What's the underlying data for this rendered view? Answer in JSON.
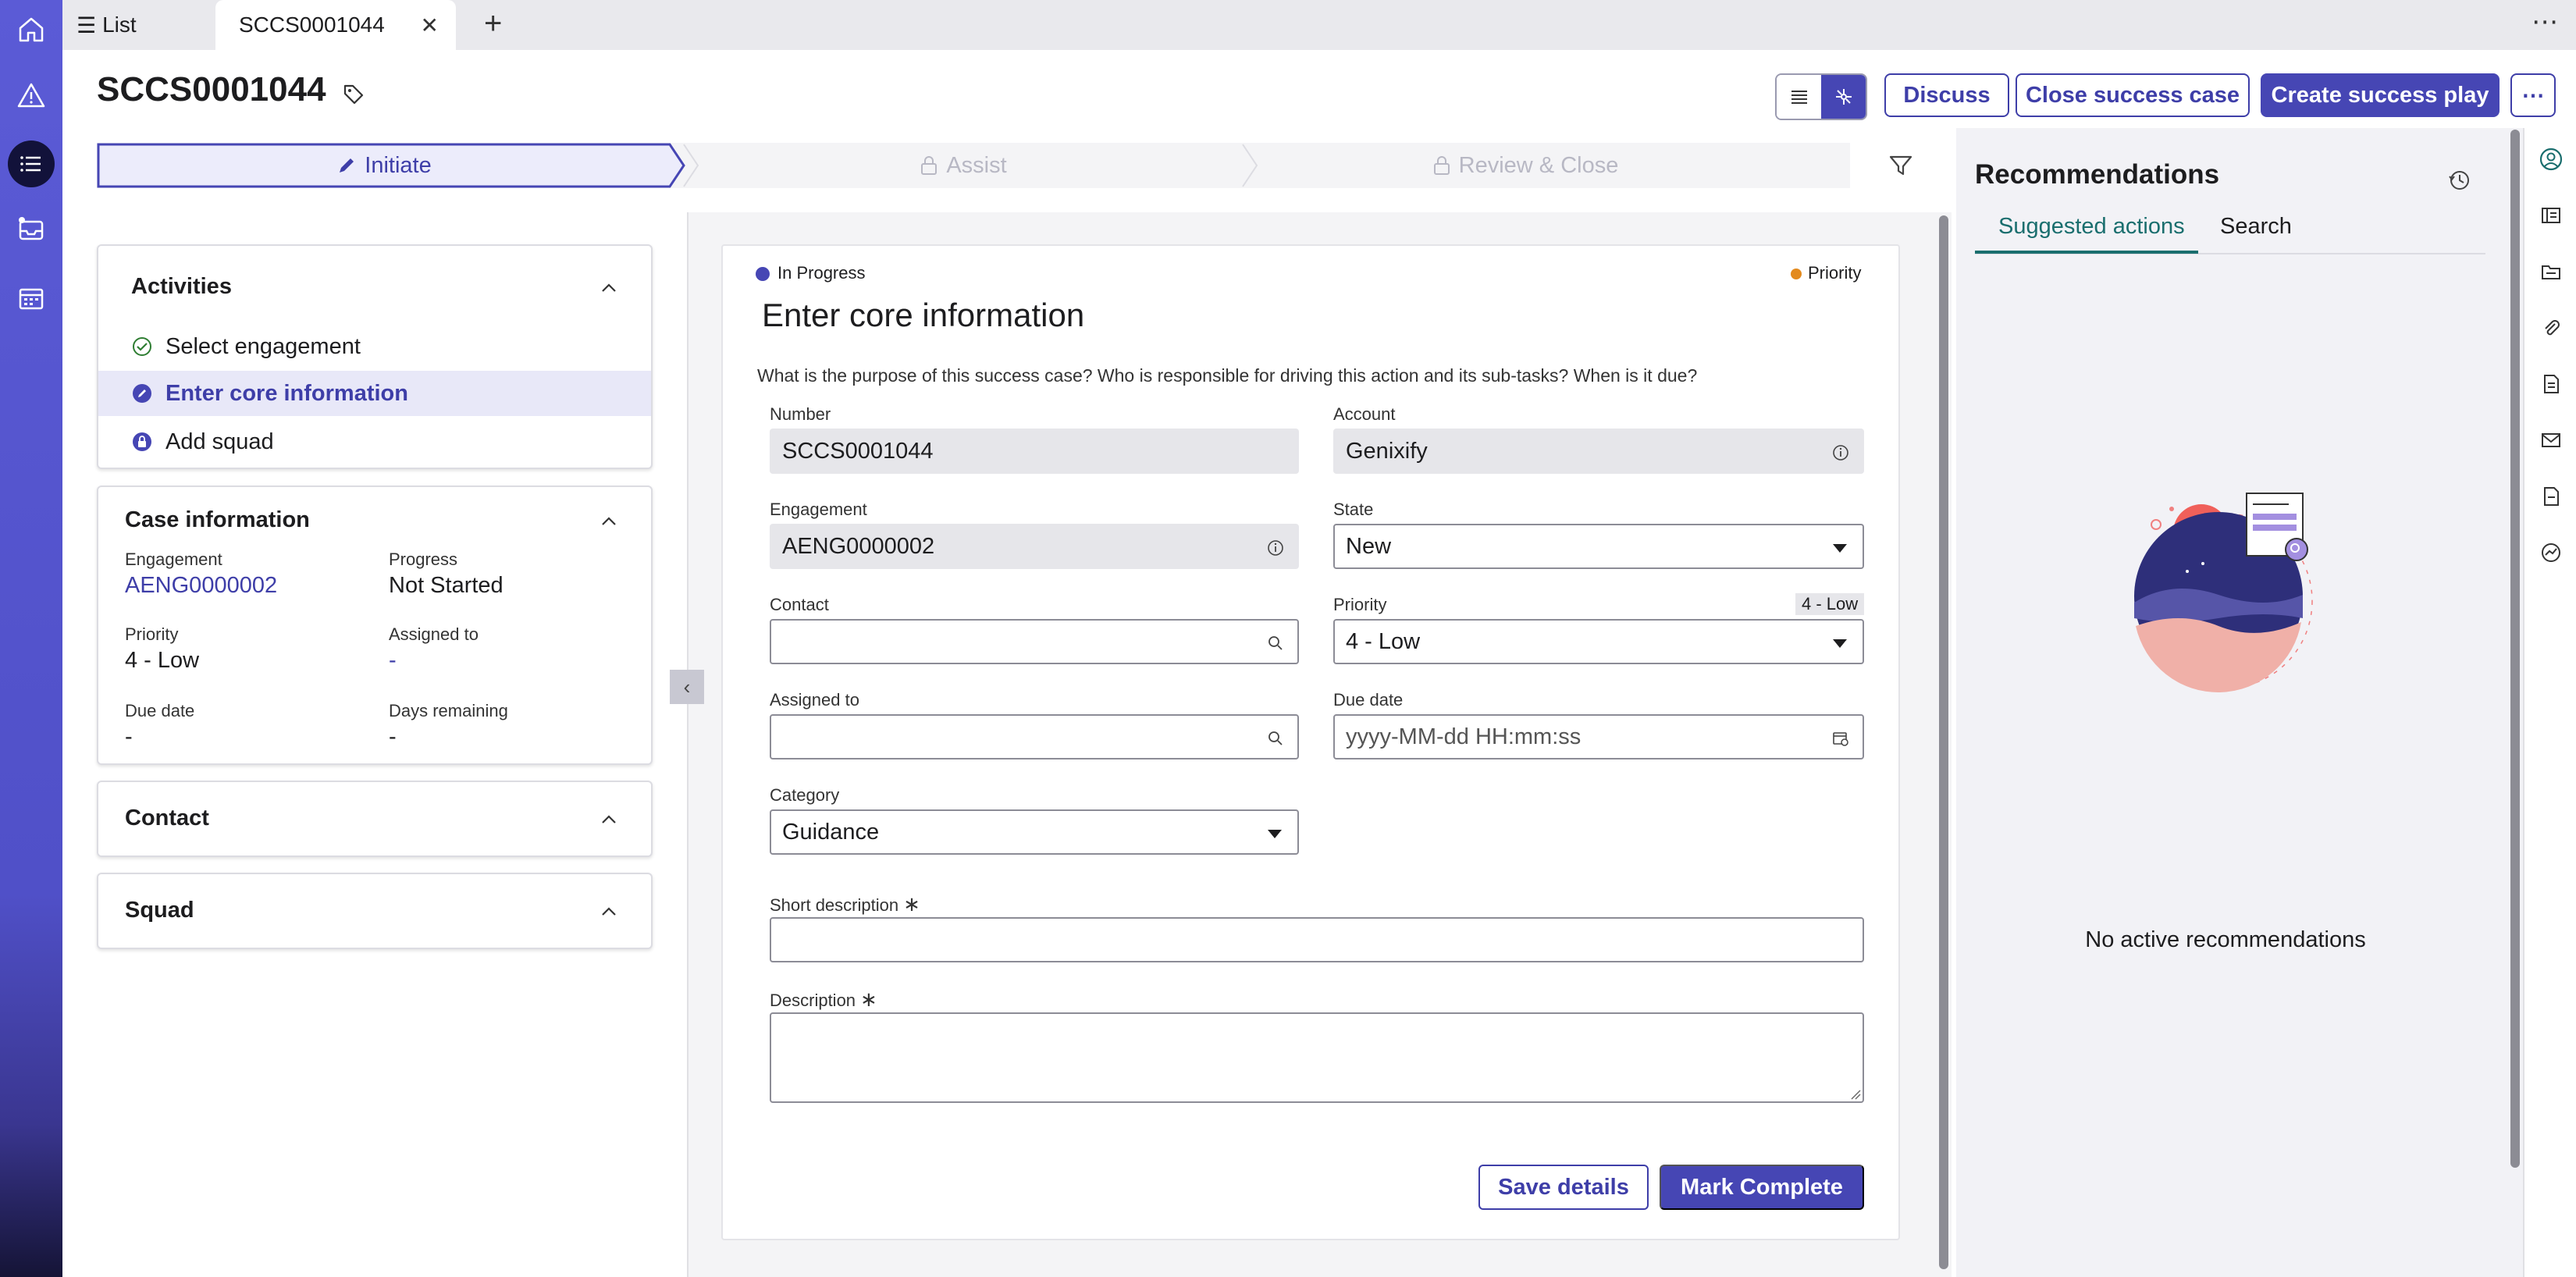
{
  "tabs": {
    "list_label": "List",
    "active_label": "SCCS0001044",
    "close_glyph": "✕",
    "add_glyph": "+",
    "more_glyph": "⋯"
  },
  "header": {
    "title": "SCCS0001044",
    "buttons": {
      "discuss": "Discuss",
      "close_case": "Close success case",
      "create_play": "Create success play",
      "more": "⋯"
    }
  },
  "stages": [
    {
      "label": "Initiate",
      "state": "active"
    },
    {
      "label": "Assist",
      "state": "locked"
    },
    {
      "label": "Review & Close",
      "state": "locked"
    }
  ],
  "activities": {
    "title": "Activities",
    "items": [
      {
        "label": "Select engagement",
        "status": "done"
      },
      {
        "label": "Enter core information",
        "status": "current"
      },
      {
        "label": "Add squad",
        "status": "locked"
      }
    ]
  },
  "case_info": {
    "title": "Case information",
    "engagement_label": "Engagement",
    "engagement_value": "AENG0000002",
    "progress_label": "Progress",
    "progress_value": "Not Started",
    "priority_label": "Priority",
    "priority_value": "4 - Low",
    "assigned_label": "Assigned to",
    "assigned_value": "-",
    "due_label": "Due date",
    "due_value": "-",
    "days_label": "Days remaining",
    "days_value": "-"
  },
  "contact_card": {
    "title": "Contact"
  },
  "squad_card": {
    "title": "Squad"
  },
  "form": {
    "status": "In Progress",
    "priority_tag": "Priority",
    "heading": "Enter core information",
    "question": "What is the purpose of this success case? Who is responsible for driving this action and its sub-tasks? When is it due?",
    "number_label": "Number",
    "number_value": "SCCS0001044",
    "account_label": "Account",
    "account_value": "Genixify",
    "engagement_label": "Engagement",
    "engagement_value": "AENG0000002",
    "state_label": "State",
    "state_value": "New",
    "contact_label": "Contact",
    "contact_value": "",
    "priority_label": "Priority",
    "priority_badge": "4 - Low",
    "priority_value": "4 - Low",
    "assigned_label": "Assigned to",
    "assigned_value": "",
    "due_label": "Due date",
    "due_placeholder": "yyyy-MM-dd HH:mm:ss",
    "category_label": "Category",
    "category_value": "Guidance",
    "short_desc_label": "Short description",
    "desc_label": "Description",
    "required_mark": "∗",
    "save_label": "Save details",
    "complete_label": "Mark Complete"
  },
  "recommendations": {
    "title": "Recommendations",
    "tab_suggested": "Suggested actions",
    "tab_search": "Search",
    "empty_text": "No active recommendations"
  },
  "colors": {
    "brand": "#4646b4",
    "accent_teal": "#1a6e6e",
    "priority_orange": "#e38a1e"
  }
}
